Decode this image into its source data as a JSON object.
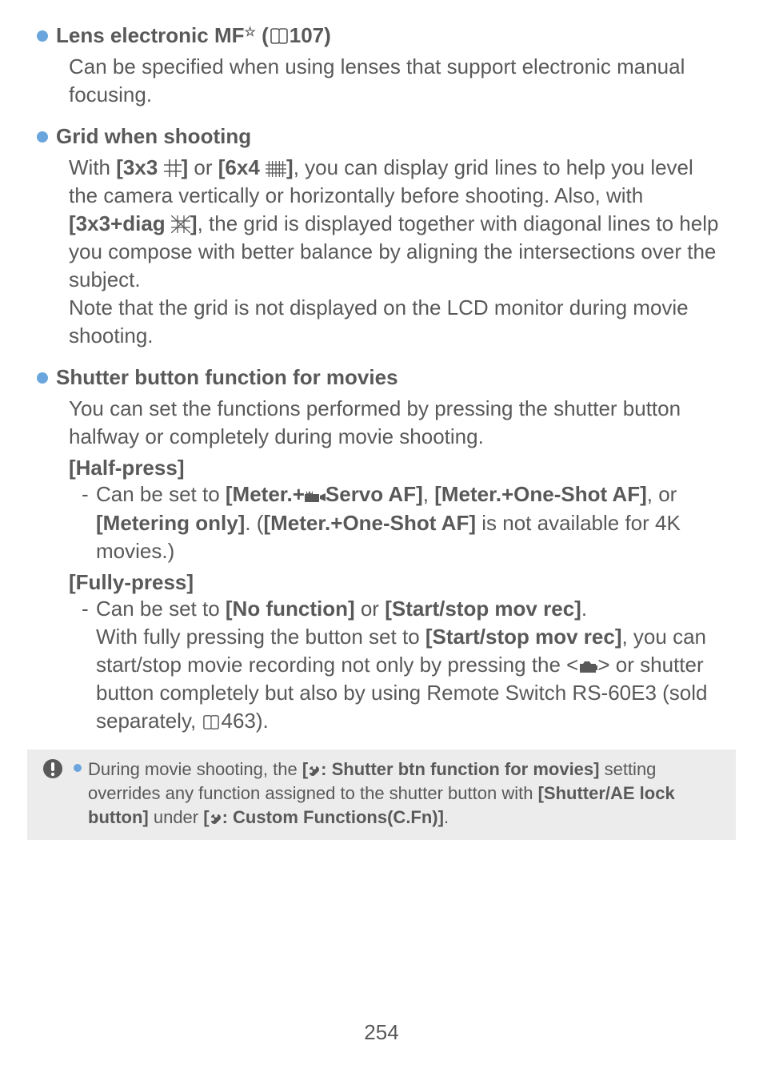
{
  "sections": [
    {
      "id": "lens-mf",
      "heading_pre": "Lens electronic MF",
      "heading_star": "☆",
      "heading_post_open": " (",
      "heading_ref": "107)",
      "body": "Can be specified when using lenses that support electronic manual focusing."
    },
    {
      "id": "grid",
      "heading": "Grid when shooting",
      "body_parts": {
        "t1": "With ",
        "opt1": "[3x3",
        "opt1_close": "]",
        "t2": " or ",
        "opt2": "[6x4",
        "opt2_close": "]",
        "t3": ", you can display grid lines to help you level the camera vertically or horizontally before shooting. Also, with ",
        "opt3": "[3x3+diag",
        "opt3_close": "]",
        "t4": ", the grid is displayed together with diagonal lines to help you compose with better balance by aligning the intersections over the subject.",
        "p2": "Note that the grid is not displayed on the LCD monitor during movie shooting."
      }
    },
    {
      "id": "shutter",
      "heading": "Shutter button function for movies",
      "intro": "You can set the functions performed by pressing the shutter button halfway or completely during movie shooting.",
      "half_label": "[Half-press]",
      "half_item": {
        "t1": "Can be set to ",
        "b1_pre": "[Meter.+",
        "b1_post": "Servo AF]",
        "t2": ", ",
        "b2": "[Meter.+One-Shot AF]",
        "t3": ", or ",
        "b3": "[Metering only]",
        "t4": ". (",
        "b4": "[Meter.+One-Shot AF]",
        "t5": " is not available for 4K movies.)"
      },
      "full_label": "[Fully-press]",
      "full_item": {
        "t1": "Can be set to ",
        "b1": "[No function]",
        "t2": " or ",
        "b2": "[Start/stop mov rec]",
        "t3": ".",
        "p2a": "With fully pressing the button set to ",
        "b3": "[Start/stop mov rec]",
        "p2b": ", you can start/stop movie recording not only by pressing the <",
        "p2c": "> or shutter button completely but also by using Remote Switch RS-60E3 (sold separately, ",
        "ref2": "463)."
      }
    }
  ],
  "note": {
    "t1": "During movie shooting, the ",
    "b1_pre": "[",
    "b1_post": ": Shutter btn function for movies]",
    "t2": " setting overrides any function assigned to the shutter button with ",
    "b2": "[Shutter/AE lock button]",
    "t3": " under ",
    "b3_pre": "[",
    "b3_post": ": Custom Functions(C.Fn)]",
    "t4": "."
  },
  "page_number": "254"
}
